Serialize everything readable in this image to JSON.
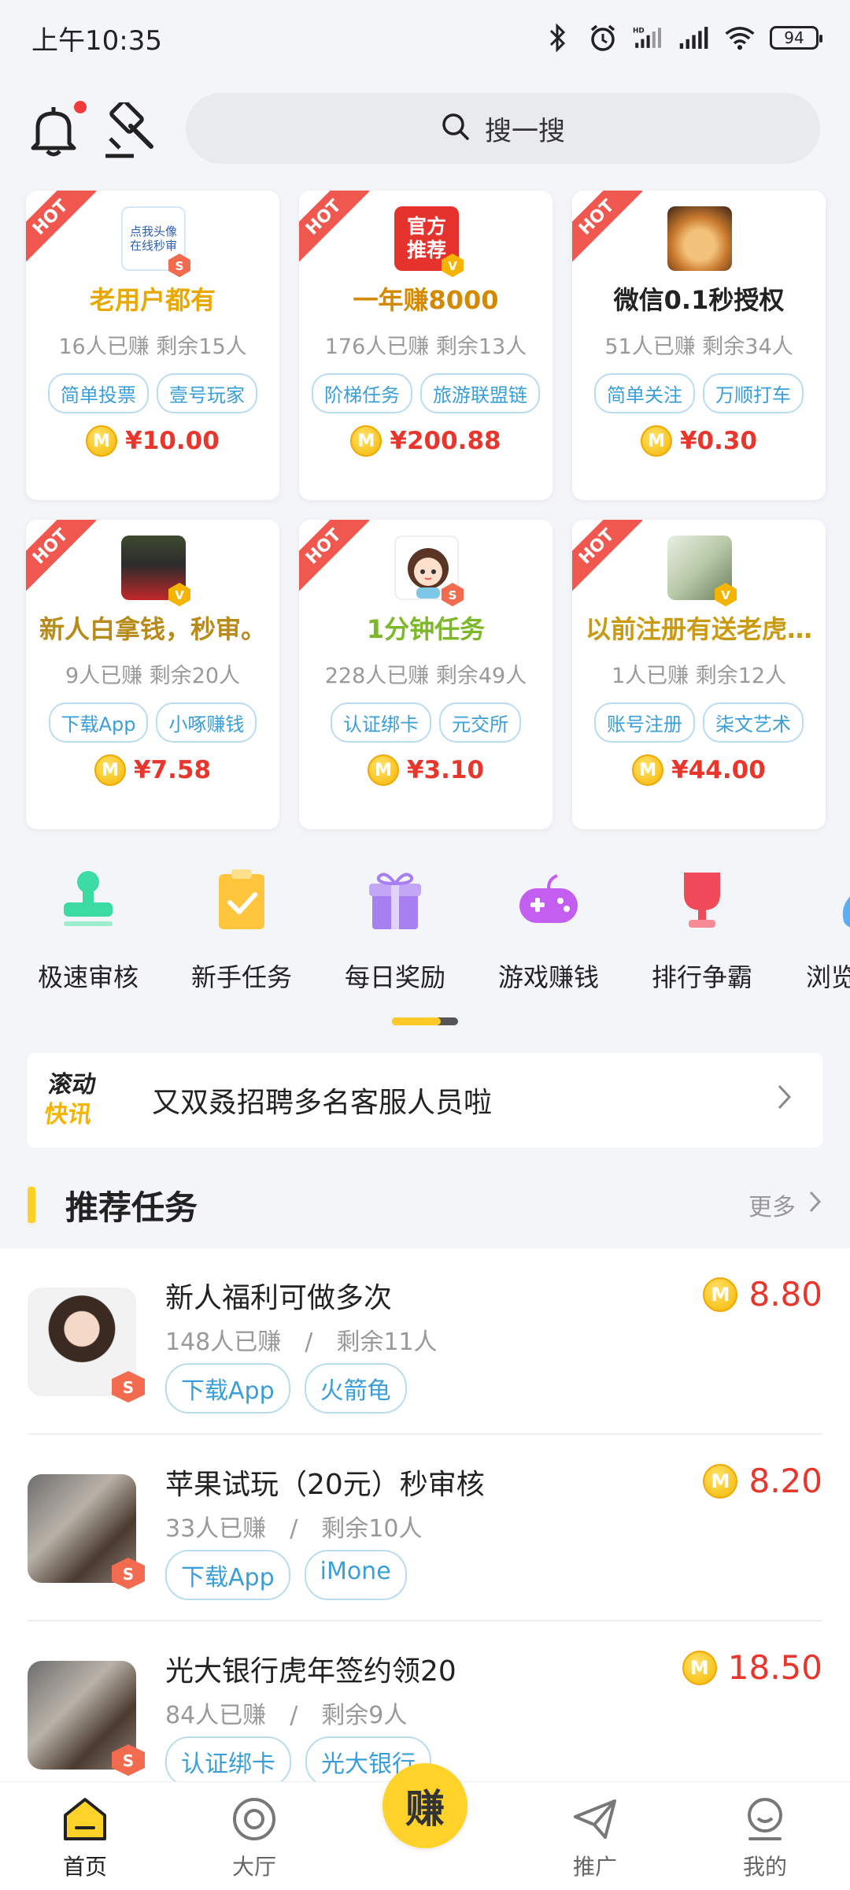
{
  "status": {
    "time": "上午10:35",
    "battery": "94"
  },
  "header": {
    "search_placeholder": "搜一搜"
  },
  "cards": [
    {
      "title": "老用户都有",
      "stats": "16人已赚 剩余15人",
      "tags": [
        "简单投票",
        "壹号玩家"
      ],
      "price": "¥10.00",
      "avatar_text": "点我头像在线秒审",
      "hot": "HOT"
    },
    {
      "title": "一年赚8000",
      "stats": "176人已赚 剩余13人",
      "tags": [
        "阶梯任务",
        "旅游联盟链"
      ],
      "price": "¥200.88",
      "avatar_text": "官方推荐",
      "hot": "HOT"
    },
    {
      "title": "微信0.1秒授权",
      "stats": "51人已赚 剩余34人",
      "tags": [
        "简单关注",
        "万顺打车"
      ],
      "price": "¥0.30",
      "hot": "HOT"
    },
    {
      "title": "新人白拿钱，秒审。",
      "stats": "9人已赚 剩余20人",
      "tags": [
        "下载App",
        "小啄赚钱"
      ],
      "price": "¥7.58",
      "hot": "HOT"
    },
    {
      "title": "1分钟任务",
      "stats": "228人已赚 剩余49人",
      "tags": [
        "认证绑卡",
        "元交所"
      ],
      "price": "¥3.10",
      "hot": "HOT"
    },
    {
      "title": "以前注册有送老虎…",
      "stats": "1人已赚 剩余12人",
      "tags": [
        "账号注册",
        "柒文艺术"
      ],
      "price": "¥44.00",
      "hot": "HOT"
    }
  ],
  "coin_letter": "M",
  "quick_menu": [
    {
      "label": "极速审核",
      "icon": "stamp-icon",
      "color": "#3ddba4"
    },
    {
      "label": "新手任务",
      "icon": "clipboard-check-icon",
      "color": "#ffc53d"
    },
    {
      "label": "每日奖励",
      "icon": "gift-icon",
      "color": "#a77ff0"
    },
    {
      "label": "游戏赚钱",
      "icon": "gamepad-icon",
      "color": "#c35ef0"
    },
    {
      "label": "排行争霸",
      "icon": "trophy-icon",
      "color": "#f04a5a"
    },
    {
      "label": "浏览",
      "icon": "money-bag-icon",
      "color": "#5aaef5"
    }
  ],
  "news": {
    "logo_line1": "滚动",
    "logo_line2": "快讯",
    "text": "又双叒招聘多名客服人员啦"
  },
  "recommended": {
    "title": "推荐任务",
    "more": "更多",
    "items": [
      {
        "title": "新人福利可做多次",
        "earned": "148人已赚",
        "sep": "/",
        "remaining": "剩余11人",
        "tags": [
          "下载App",
          "火箭龟"
        ],
        "price": "8.80"
      },
      {
        "title": "苹果试玩（20元）秒审核",
        "earned": "33人已赚",
        "sep": "/",
        "remaining": "剩余10人",
        "tags": [
          "下载App",
          "iMone"
        ],
        "price": "8.20"
      },
      {
        "title": "光大银行虎年签约领20",
        "earned": "84人已赚",
        "sep": "/",
        "remaining": "剩余9人",
        "tags": [
          "认证绑卡",
          "光大银行"
        ],
        "price": "18.50"
      }
    ]
  },
  "nav": {
    "home": "首页",
    "hall": "大厅",
    "earn": "赚",
    "promote": "推广",
    "mine": "我的"
  },
  "colors": {
    "accent": "#ffd126",
    "price": "#e8362c",
    "tag": "#3a9fd8",
    "hot": "#f0574e"
  }
}
